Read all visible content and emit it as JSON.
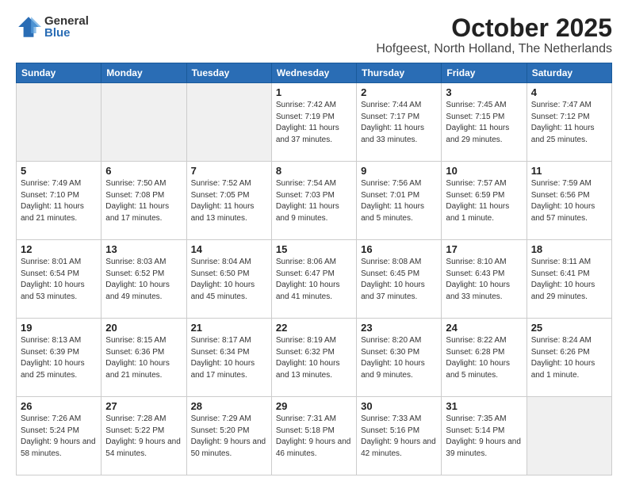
{
  "logo": {
    "general": "General",
    "blue": "Blue"
  },
  "title": "October 2025",
  "subtitle": "Hofgeest, North Holland, The Netherlands",
  "weekdays": [
    "Sunday",
    "Monday",
    "Tuesday",
    "Wednesday",
    "Thursday",
    "Friday",
    "Saturday"
  ],
  "weeks": [
    [
      {
        "day": null,
        "shade": true
      },
      {
        "day": null,
        "shade": true
      },
      {
        "day": null,
        "shade": true
      },
      {
        "day": "1",
        "sunrise": "7:42 AM",
        "sunset": "7:19 PM",
        "daylight": "11 hours and 37 minutes."
      },
      {
        "day": "2",
        "sunrise": "7:44 AM",
        "sunset": "7:17 PM",
        "daylight": "11 hours and 33 minutes."
      },
      {
        "day": "3",
        "sunrise": "7:45 AM",
        "sunset": "7:15 PM",
        "daylight": "11 hours and 29 minutes."
      },
      {
        "day": "4",
        "sunrise": "7:47 AM",
        "sunset": "7:12 PM",
        "daylight": "11 hours and 25 minutes."
      }
    ],
    [
      {
        "day": "5",
        "sunrise": "7:49 AM",
        "sunset": "7:10 PM",
        "daylight": "11 hours and 21 minutes."
      },
      {
        "day": "6",
        "sunrise": "7:50 AM",
        "sunset": "7:08 PM",
        "daylight": "11 hours and 17 minutes."
      },
      {
        "day": "7",
        "sunrise": "7:52 AM",
        "sunset": "7:05 PM",
        "daylight": "11 hours and 13 minutes."
      },
      {
        "day": "8",
        "sunrise": "7:54 AM",
        "sunset": "7:03 PM",
        "daylight": "11 hours and 9 minutes."
      },
      {
        "day": "9",
        "sunrise": "7:56 AM",
        "sunset": "7:01 PM",
        "daylight": "11 hours and 5 minutes."
      },
      {
        "day": "10",
        "sunrise": "7:57 AM",
        "sunset": "6:59 PM",
        "daylight": "11 hours and 1 minute."
      },
      {
        "day": "11",
        "sunrise": "7:59 AM",
        "sunset": "6:56 PM",
        "daylight": "10 hours and 57 minutes."
      }
    ],
    [
      {
        "day": "12",
        "sunrise": "8:01 AM",
        "sunset": "6:54 PM",
        "daylight": "10 hours and 53 minutes."
      },
      {
        "day": "13",
        "sunrise": "8:03 AM",
        "sunset": "6:52 PM",
        "daylight": "10 hours and 49 minutes."
      },
      {
        "day": "14",
        "sunrise": "8:04 AM",
        "sunset": "6:50 PM",
        "daylight": "10 hours and 45 minutes."
      },
      {
        "day": "15",
        "sunrise": "8:06 AM",
        "sunset": "6:47 PM",
        "daylight": "10 hours and 41 minutes."
      },
      {
        "day": "16",
        "sunrise": "8:08 AM",
        "sunset": "6:45 PM",
        "daylight": "10 hours and 37 minutes."
      },
      {
        "day": "17",
        "sunrise": "8:10 AM",
        "sunset": "6:43 PM",
        "daylight": "10 hours and 33 minutes."
      },
      {
        "day": "18",
        "sunrise": "8:11 AM",
        "sunset": "6:41 PM",
        "daylight": "10 hours and 29 minutes."
      }
    ],
    [
      {
        "day": "19",
        "sunrise": "8:13 AM",
        "sunset": "6:39 PM",
        "daylight": "10 hours and 25 minutes."
      },
      {
        "day": "20",
        "sunrise": "8:15 AM",
        "sunset": "6:36 PM",
        "daylight": "10 hours and 21 minutes."
      },
      {
        "day": "21",
        "sunrise": "8:17 AM",
        "sunset": "6:34 PM",
        "daylight": "10 hours and 17 minutes."
      },
      {
        "day": "22",
        "sunrise": "8:19 AM",
        "sunset": "6:32 PM",
        "daylight": "10 hours and 13 minutes."
      },
      {
        "day": "23",
        "sunrise": "8:20 AM",
        "sunset": "6:30 PM",
        "daylight": "10 hours and 9 minutes."
      },
      {
        "day": "24",
        "sunrise": "8:22 AM",
        "sunset": "6:28 PM",
        "daylight": "10 hours and 5 minutes."
      },
      {
        "day": "25",
        "sunrise": "8:24 AM",
        "sunset": "6:26 PM",
        "daylight": "10 hours and 1 minute."
      }
    ],
    [
      {
        "day": "26",
        "sunrise": "7:26 AM",
        "sunset": "5:24 PM",
        "daylight": "9 hours and 58 minutes."
      },
      {
        "day": "27",
        "sunrise": "7:28 AM",
        "sunset": "5:22 PM",
        "daylight": "9 hours and 54 minutes."
      },
      {
        "day": "28",
        "sunrise": "7:29 AM",
        "sunset": "5:20 PM",
        "daylight": "9 hours and 50 minutes."
      },
      {
        "day": "29",
        "sunrise": "7:31 AM",
        "sunset": "5:18 PM",
        "daylight": "9 hours and 46 minutes."
      },
      {
        "day": "30",
        "sunrise": "7:33 AM",
        "sunset": "5:16 PM",
        "daylight": "9 hours and 42 minutes."
      },
      {
        "day": "31",
        "sunrise": "7:35 AM",
        "sunset": "5:14 PM",
        "daylight": "9 hours and 39 minutes."
      },
      {
        "day": null,
        "shade": true
      }
    ]
  ]
}
